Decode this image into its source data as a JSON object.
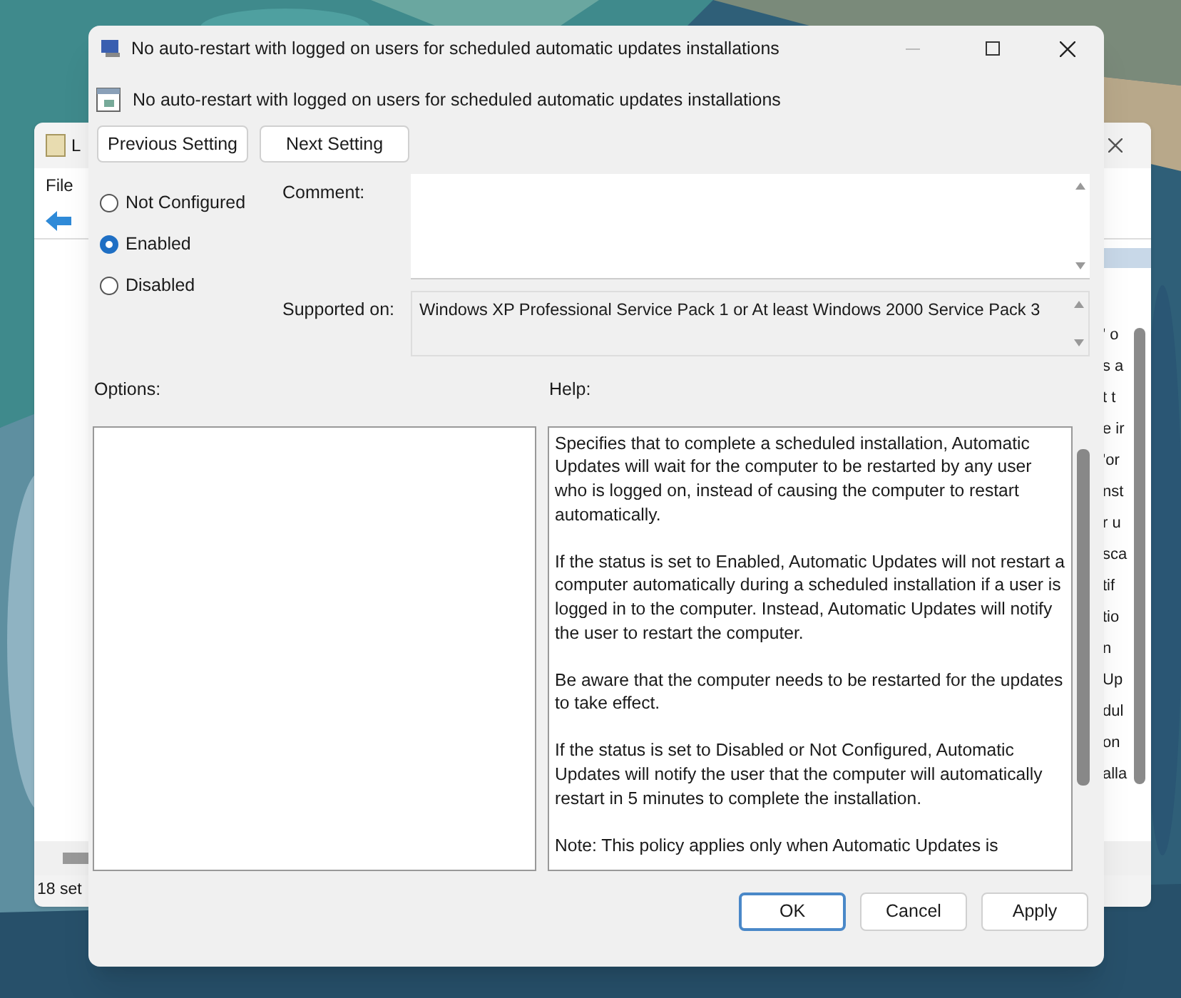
{
  "back_window": {
    "title": "L",
    "menu": [
      "File"
    ],
    "status_bar": "18 set",
    "column_fragments": [
      "' o",
      "s a",
      "t t",
      "e ir",
      "'or",
      "nst",
      "r u",
      "sca",
      "tif",
      "tio",
      "n",
      "Up",
      "dul",
      "on",
      "alla"
    ]
  },
  "dialog": {
    "title": "No auto-restart with logged on users for scheduled automatic updates installations",
    "header": "No auto-restart with logged on users for scheduled automatic updates installations",
    "nav_buttons": [
      "Previous Setting",
      "Next Setting"
    ],
    "states": [
      {
        "label": "Not Configured",
        "selected": false
      },
      {
        "label": "Enabled",
        "selected": true
      },
      {
        "label": "Disabled",
        "selected": false
      }
    ],
    "comment_label": "Comment:",
    "supported_label": "Supported on:",
    "supported_value": "Windows XP Professional Service Pack 1 or At least Windows 2000 Service Pack 3",
    "options_label": "Options:",
    "help_label": "Help:",
    "help": [
      "Specifies that to complete a scheduled installation, Automatic Updates will wait for the computer to be restarted by any user who is logged on, instead of causing the computer to restart automatically.",
      "If the status is set to Enabled, Automatic Updates will not restart a computer automatically during a scheduled installation if a user is logged in to the computer. Instead, Automatic Updates will notify the user to restart the computer.",
      "Be aware that the computer needs to be restarted for the updates to take effect.",
      "If the status is set to Disabled or Not Configured, Automatic Updates will notify the user that the computer will automatically restart in 5 minutes to complete the installation.",
      "Note: This policy applies only when Automatic Updates is"
    ],
    "buttons": [
      {
        "label": "OK",
        "kind": "default"
      },
      {
        "label": "Cancel",
        "kind": "normal"
      },
      {
        "label": "Apply",
        "kind": "normal"
      }
    ]
  }
}
